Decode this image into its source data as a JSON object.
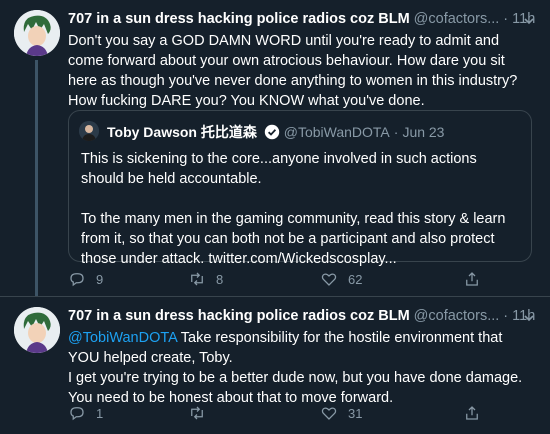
{
  "tweets": [
    {
      "name": "707 in a sun dress hacking police radios coz BLM",
      "handle": "@cofactors...",
      "sep": "·",
      "time": "11h",
      "text": "Don't you say a GOD DAMN WORD until you're ready to admit and come forward about your own atrocious behaviour. How dare you sit here as though you've never done anything to women in this industry? How fucking DARE you? You KNOW what you've done.",
      "quote": {
        "name": "Toby Dawson 托比道森",
        "handle": "@TobiWanDOTA",
        "sep": "·",
        "date": "Jun 23",
        "p1": "This is sickening to the core...anyone involved in such actions should be held accountable.",
        "p2": "To the many men in the gaming community,  read this story & learn from it, so that you can both not be a participant and also protect those under attack. twitter.com/Wickedscosplay..."
      },
      "replies": "9",
      "retweets": "8",
      "likes": "62"
    },
    {
      "name": "707 in a sun dress hacking police radios coz BLM",
      "handle": "@cofactors...",
      "sep": "·",
      "time": "11h",
      "mention": "@TobiWanDOTA",
      "line1": " Take responsibility for the hostile environment that YOU helped create, Toby.",
      "line2": "I get you're trying to be a better dude now, but you have done damage. You need to be honest about that to move forward.",
      "replies": "1",
      "retweets": "",
      "likes": "31"
    }
  ],
  "icons": [
    "reply-icon",
    "retweet-icon",
    "like-icon",
    "share-icon",
    "chevron-down-icon",
    "verified-badge-icon"
  ],
  "colors": {
    "background": "#15202b",
    "secondary_text": "#8899a6",
    "link": "#1da1f2",
    "border": "#38444d"
  }
}
